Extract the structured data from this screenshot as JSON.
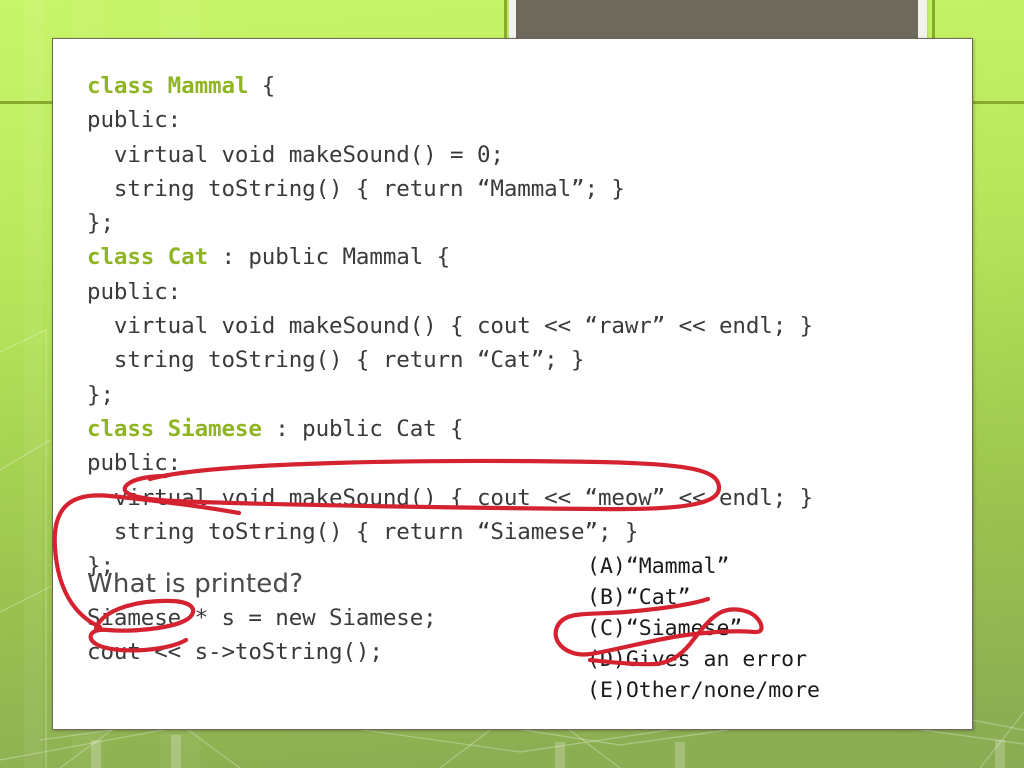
{
  "slide": {
    "background_top_color": "#c9f56a",
    "background_bottom_color": "#8aab53",
    "card_background": "#ffffff",
    "title_placeholder_color": "#6f695c",
    "title_placeholder_text": ""
  },
  "code": {
    "keyword_color": "#8fb524",
    "text_color": "#3a3a3a",
    "lines": [
      {
        "kw": "class Mammal",
        "rest": " {"
      },
      {
        "kw": "",
        "rest": "public:"
      },
      {
        "kw": "",
        "rest": "  virtual void makeSound() = 0;"
      },
      {
        "kw": "",
        "rest": "  string toString() { return “Mammal”; }"
      },
      {
        "kw": "",
        "rest": "};"
      },
      {
        "kw": "class Cat",
        "rest": " : public Mammal {"
      },
      {
        "kw": "",
        "rest": "public:"
      },
      {
        "kw": "",
        "rest": "  virtual void makeSound() { cout << “rawr” << endl; }"
      },
      {
        "kw": "",
        "rest": "  string toString() { return “Cat”; }"
      },
      {
        "kw": "",
        "rest": "};"
      },
      {
        "kw": "class Siamese",
        "rest": " : public Cat {"
      },
      {
        "kw": "",
        "rest": "public:"
      },
      {
        "kw": "",
        "rest": "  virtual void makeSound() { cout << “meow” << endl; }"
      },
      {
        "kw": "",
        "rest": "  string toString() { return “Siamese”; }"
      },
      {
        "kw": "",
        "rest": "};"
      }
    ]
  },
  "question": {
    "prompt": "What is printed?"
  },
  "post_code": {
    "lines": [
      "Siamese * s = new Siamese;",
      "cout << s->toString();"
    ]
  },
  "answers": {
    "options": [
      {
        "key": "(A)",
        "text": "“Mammal”"
      },
      {
        "key": "(B)",
        "text": "“Cat”"
      },
      {
        "key": "(C)",
        "text": "“Siamese”"
      },
      {
        "key": "(D)",
        "text": "Gives an error"
      },
      {
        "key": "(E)",
        "text": "Other/none/more"
      }
    ]
  },
  "annotations": {
    "ink_color": "#d42230",
    "marks": [
      "ellipse-around-siamese-tostring-line",
      "long-curve-to-siamese-declaration",
      "ellipse-around-siamese-variable-type",
      "ellipse-around-answer-c"
    ]
  }
}
